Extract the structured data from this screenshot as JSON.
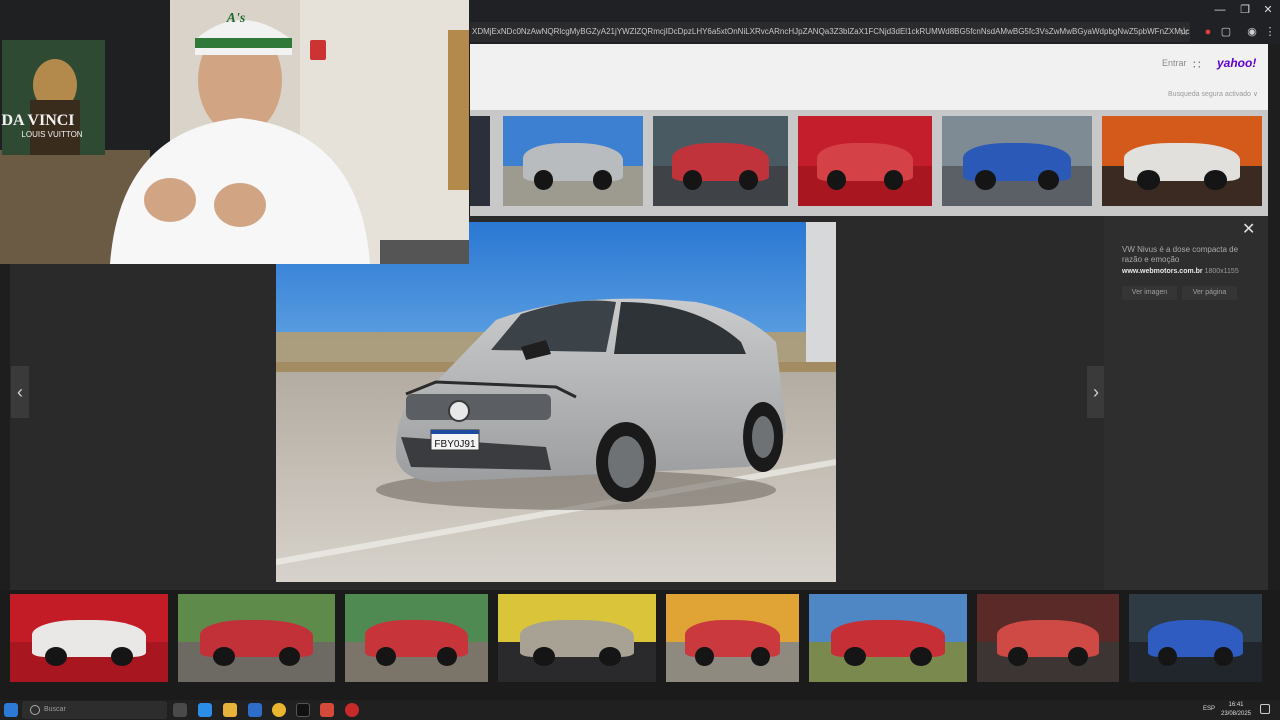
{
  "browser": {
    "address": "XDMjExNDc0NzAwNQRlcgMyBGZyA21jYWZlZQRmcjIDcDpzLHY6a5xtOnNiLXRvcARncHJpZANQa3Z3blZaX1FCNjd3dEl1ckRUMWd8BG5fcnNsdAMwBG5fc3VsZwMwBGyaWdpbgNwZ5pbWFnZXMuc2VhcmNoLnlhaG9vLmNvbQ..."
  },
  "yahoo": {
    "signin": "Entrar",
    "logo": "yahoo!",
    "safe_search": "Busqueda segura activado ∨"
  },
  "viewer": {
    "title": "VW Nivus é a dose compacta de razão e emoção",
    "source": "www.webmotors.com.br",
    "dims": "1800x1155",
    "view_image": "Ver imagen",
    "view_page": "Ver página",
    "plate": "FBY0J91"
  },
  "webcam": {
    "poster_line1": "DA VINCI",
    "poster_line2": "LOUIS VUITTON",
    "cap_logo": "A's"
  },
  "taskbar": {
    "search_placeholder": "Buscar",
    "lang": "ESP",
    "time": "16:41",
    "date": "23/08/2025"
  },
  "icons": [
    "close-icon",
    "chevron-left-icon",
    "chevron-right-icon",
    "apps-grid-icon",
    "star-icon",
    "extensions-icon",
    "search-icon"
  ],
  "colors": {
    "accent_yahoo": "#6001d2",
    "viewer_bg": "#2a2a2a"
  }
}
